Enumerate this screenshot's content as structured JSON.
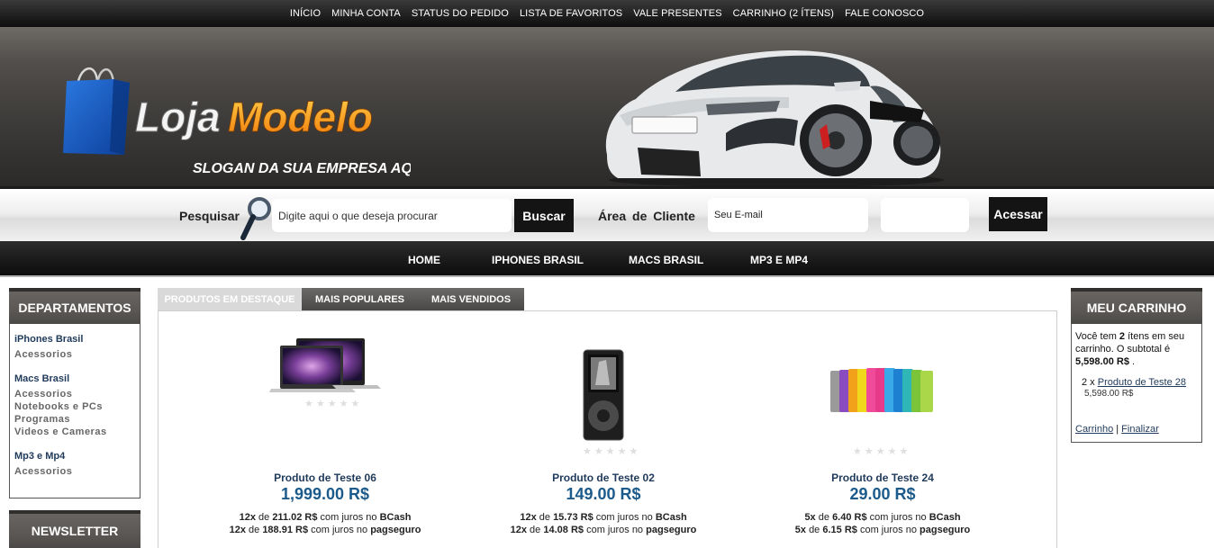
{
  "top_menu": [
    "INÍCIO",
    "MINHA CONTA",
    "STATUS DO PEDIDO",
    "LISTA DE FAVORITOS",
    "VALE PRESENTES",
    "CARRINHO (2 ÍTENS)",
    "FALE CONOSCO"
  ],
  "logo": {
    "name_part1": "Loja",
    "name_part2": "Modelo",
    "slogan": "SLOGAN DA SUA EMPRESA AQUI"
  },
  "search": {
    "label": "Pesquisar",
    "placeholder": "Digite aqui o que deseja procurar",
    "button": "Buscar"
  },
  "client_area": {
    "label": "Área de Cliente",
    "email_placeholder": "Seu E-mail",
    "button": "Acessar"
  },
  "main_nav": [
    "HOME",
    "IPHONES BRASIL",
    "MACS BRASIL",
    "MP3 E MP4"
  ],
  "departments": {
    "title": "DEPARTAMENTOS",
    "groups": [
      {
        "title": "iPhones Brasil",
        "items": [
          "Acessorios"
        ]
      },
      {
        "title": "Macs Brasil",
        "items": [
          "Acessorios",
          "Notebooks e PCs",
          "Programas",
          "Videos e Cameras"
        ]
      },
      {
        "title": "Mp3 e Mp4",
        "items": [
          "Acessorios"
        ]
      }
    ]
  },
  "newsletter": {
    "title": "NEWSLETTER"
  },
  "tabs": [
    "PRODUTOS EM DESTAQUE",
    "MAIS POPULARES",
    "MAIS VENDIDOS"
  ],
  "products": [
    {
      "name": "Produto de Teste 06",
      "price": "1,999.00 R$",
      "inst1_n": "12x",
      "inst1_v": "211.02 R$",
      "inst1_via": "BCash",
      "inst2_n": "12x",
      "inst2_v": "188.91 R$",
      "inst2_via": "pagseguro",
      "image": "macbook"
    },
    {
      "name": "Produto de Teste 02",
      "price": "149.00 R$",
      "inst1_n": "12x",
      "inst1_v": "15.73 R$",
      "inst1_via": "BCash",
      "inst2_n": "12x",
      "inst2_v": "14.08 R$",
      "inst2_via": "pagseguro",
      "image": "ipod-nano"
    },
    {
      "name": "Produto de Teste 24",
      "price": "29.00 R$",
      "inst1_n": "5x",
      "inst1_v": "6.40 R$",
      "inst1_via": "BCash",
      "inst2_n": "5x",
      "inst2_v": "6.15 R$",
      "inst2_via": "pagseguro",
      "image": "colored-socks"
    }
  ],
  "installment_words": {
    "de": "de",
    "com_juros": "com juros no"
  },
  "cart": {
    "title": "MEU CARRINHO",
    "line1": "Você tem",
    "count": "2",
    "line2": "ítens em seu carrinho. O subtotal é",
    "subtotal": "5,598.00 R$",
    "period": ".",
    "item_qty": "2 x",
    "item_name": "Produto de Teste 28",
    "item_price": "5,598.00 R$",
    "link_cart": "Carrinho",
    "separator": "|",
    "link_checkout": "Finalizar"
  },
  "colors": {
    "dark": "#141414",
    "link": "#1f3a5a",
    "price": "#1b5a8a",
    "accent_orange": "#f39a12"
  }
}
